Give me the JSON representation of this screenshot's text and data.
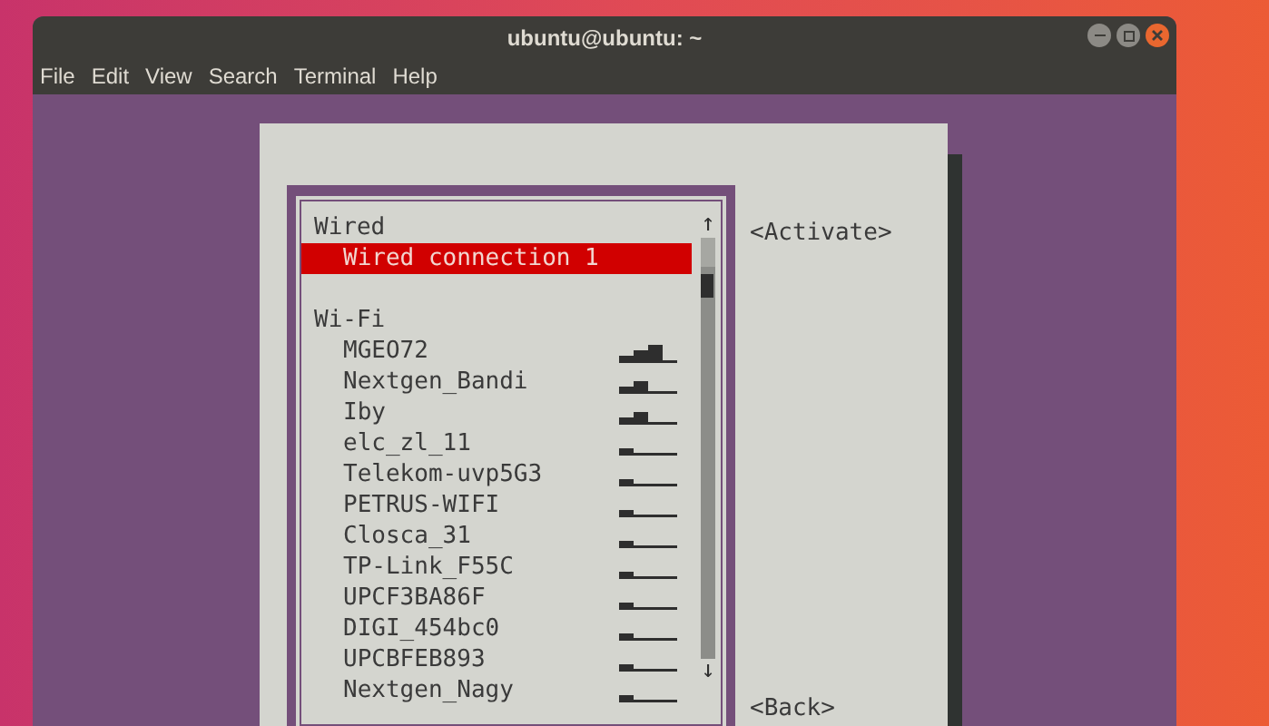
{
  "window": {
    "title": "ubuntu@ubuntu: ~"
  },
  "menu": [
    "File",
    "Edit",
    "View",
    "Search",
    "Terminal",
    "Help"
  ],
  "list": {
    "scroll_up": "↑",
    "scroll_down": "↓",
    "sections": [
      {
        "header": "Wired",
        "items": [
          {
            "name": "Wired connection 1",
            "selected": true
          }
        ]
      },
      {
        "header": "Wi-Fi",
        "items": [
          {
            "name": "MGEO72",
            "level": 0.75,
            "selected": false
          },
          {
            "name": "Nextgen_Bandi",
            "level": 0.5,
            "selected": false
          },
          {
            "name": "Iby",
            "level": 0.5,
            "selected": false
          },
          {
            "name": "elc_zl_11",
            "level": 0.25,
            "selected": false
          },
          {
            "name": "Telekom-uvp5G3",
            "level": 0.25,
            "selected": false
          },
          {
            "name": "PETRUS-WIFI",
            "level": 0.25,
            "selected": false
          },
          {
            "name": "Closca_31",
            "level": 0.25,
            "selected": false
          },
          {
            "name": "TP-Link_F55C",
            "level": 0.25,
            "selected": false
          },
          {
            "name": "UPCF3BA86F",
            "level": 0.25,
            "selected": false
          },
          {
            "name": "DIGI_454bc0",
            "level": 0.25,
            "selected": false
          },
          {
            "name": "UPCBFEB893",
            "level": 0.25,
            "selected": false
          },
          {
            "name": "Nextgen_Nagy",
            "level": 0.25,
            "selected": false
          }
        ]
      }
    ]
  },
  "buttons": [
    "<Activate>",
    "<Back>"
  ]
}
